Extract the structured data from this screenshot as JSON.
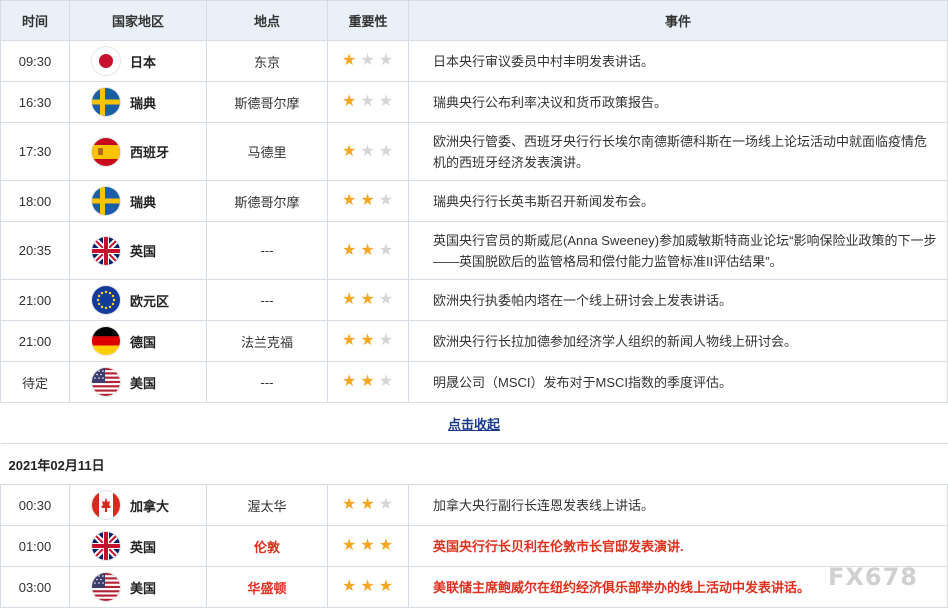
{
  "header": {
    "time": "时间",
    "country": "国家地区",
    "location": "地点",
    "importance": "重要性",
    "event": "事件"
  },
  "rows_day1": [
    {
      "time": "09:30",
      "country": "日本",
      "flag": "jp-flag",
      "location": "东京",
      "stars": 1,
      "event": "日本央行审议委员中村丰明发表讲话。",
      "highlight": false
    },
    {
      "time": "16:30",
      "country": "瑞典",
      "flag": "se-flag",
      "location": "斯德哥尔摩",
      "stars": 1,
      "event": "瑞典央行公布利率决议和货币政策报告。",
      "highlight": false
    },
    {
      "time": "17:30",
      "country": "西班牙",
      "flag": "es-flag",
      "location": "马德里",
      "stars": 1,
      "event": "欧洲央行管委、西班牙央行行长埃尔南德斯德科斯在一场线上论坛活动中就面临疫情危机的西班牙经济发表演讲。",
      "highlight": false
    },
    {
      "time": "18:00",
      "country": "瑞典",
      "flag": "se-flag",
      "location": "斯德哥尔摩",
      "stars": 2,
      "event": "瑞典央行行长英韦斯召开新闻发布会。",
      "highlight": false
    },
    {
      "time": "20:35",
      "country": "英国",
      "flag": "uk-flag",
      "location": "---",
      "stars": 2,
      "event": "英国央行官员的斯威尼(Anna Sweeney)参加威敏斯特商业论坛“影响保险业政策的下一步——英国脱欧后的监管格局和偿付能力监管标准II评估结果”。",
      "highlight": false
    },
    {
      "time": "21:00",
      "country": "欧元区",
      "flag": "eu-flag",
      "location": "---",
      "stars": 2,
      "event": "欧洲央行执委帕内塔在一个线上研讨会上发表讲话。",
      "highlight": false
    },
    {
      "time": "21:00",
      "country": "德国",
      "flag": "de-flag",
      "location": "法兰克福",
      "stars": 2,
      "event": "欧洲央行行长拉加德参加经济学人组织的新闻人物线上研讨会。",
      "highlight": false
    },
    {
      "time": "待定",
      "country": "美国",
      "flag": "us-flag",
      "location": "---",
      "stars": 2,
      "event": "明晟公司（MSCI）发布对于MSCI指数的季度评估。",
      "highlight": false
    }
  ],
  "collapse_label": "点击收起",
  "date_label": "2021年02月11日",
  "rows_day2": [
    {
      "time": "00:30",
      "country": "加拿大",
      "flag": "ca-flag",
      "location": "渥太华",
      "stars": 2,
      "event": "加拿大央行副行长连恩发表线上讲话。",
      "highlight": false
    },
    {
      "time": "01:00",
      "country": "英国",
      "flag": "uk-flag",
      "location": "伦敦",
      "stars": 3,
      "event": "英国央行行长贝利在伦敦市长官邸发表演讲.",
      "highlight": true
    },
    {
      "time": "03:00",
      "country": "美国",
      "flag": "us-flag",
      "location": "华盛顿",
      "stars": 3,
      "event": "美联储主席鲍威尔在纽约经济俱乐部举办的线上活动中发表讲话。",
      "highlight": true
    }
  ],
  "watermark": "FX678",
  "colors": {
    "header_bg": "#e9f0f8",
    "star_on": "#f5a623",
    "star_off": "#d5d5d5",
    "highlight_red": "#e0301e",
    "link": "#1a3a8c"
  }
}
